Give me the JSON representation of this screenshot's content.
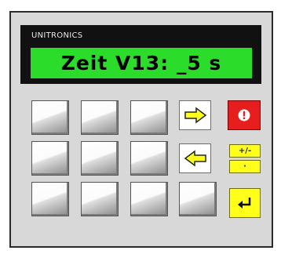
{
  "panel": {
    "brand": "UNITRONICS",
    "display_text": "Zeit V13: _5 s",
    "display_color": "#2bdc2b"
  },
  "keys": {
    "blank": [
      "blank-key",
      "blank-key",
      "blank-key",
      "blank-key",
      "blank-key",
      "blank-key",
      "blank-key",
      "blank-key",
      "blank-key",
      "blank-key"
    ],
    "right_arrow_icon": "right-arrow-icon",
    "left_arrow_icon": "left-arrow-icon",
    "esc_icon": "exclamation-icon",
    "plus_minus_label": "+/-",
    "dot_label": "·",
    "enter_icon": "enter-icon"
  },
  "colors": {
    "esc_key": "#e61e1e",
    "function_key": "#ffff1a",
    "arrow_fill": "#ffff1a"
  }
}
